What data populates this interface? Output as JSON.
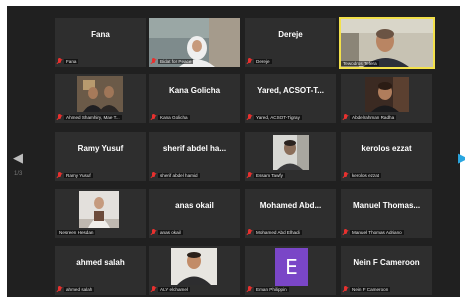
{
  "navigation": {
    "prev_arrow": "◀",
    "next_arrow": "▶",
    "page_left": "1/3"
  },
  "tiles": [
    {
      "display_name": "Fana",
      "label": "Fana",
      "muted": true,
      "has_video": false
    },
    {
      "display_name": "",
      "label": "Bidat for Peace",
      "muted": true,
      "has_video": true
    },
    {
      "display_name": "Dereje",
      "label": "Dereje",
      "muted": true,
      "has_video": false
    },
    {
      "display_name": "",
      "label": "Tewodros Tefera",
      "muted": false,
      "has_video": true,
      "active_speaker": true
    },
    {
      "display_name": "",
      "label": "Ahmed Shamhiry, Mae T...",
      "muted": true,
      "has_video": true
    },
    {
      "display_name": "Kana Golicha",
      "label": "Kana Golicha",
      "muted": true,
      "has_video": false
    },
    {
      "display_name": "Yared, ACSOT-T...",
      "label": "Yared, ACSOT-Tigray",
      "muted": true,
      "has_video": false
    },
    {
      "display_name": "",
      "label": "Abdelrahman Radha",
      "muted": true,
      "has_video": true
    },
    {
      "display_name": "Ramy Yusuf",
      "label": "Ramy Yusuf",
      "muted": true,
      "has_video": false
    },
    {
      "display_name": "sherif abdel ha...",
      "label": "sherif abdel hamid",
      "muted": true,
      "has_video": false
    },
    {
      "display_name": "",
      "label": "Essam Tawfy",
      "muted": true,
      "has_video": true
    },
    {
      "display_name": "kerolos ezzat",
      "label": "kerolos ezzat",
      "muted": true,
      "has_video": false
    },
    {
      "display_name": "",
      "label": "Nesreen Hesdan",
      "muted": false,
      "has_video": true
    },
    {
      "display_name": "anas okail",
      "label": "anas okail",
      "muted": true,
      "has_video": false
    },
    {
      "display_name": "Mohamed Abd...",
      "label": "Mohamed Abd Elhadi",
      "muted": true,
      "has_video": false
    },
    {
      "display_name": "Manuel Thomas...",
      "label": "Manuel Thomas Adriano",
      "muted": true,
      "has_video": false
    },
    {
      "display_name": "ahmed salah",
      "label": "ahmed salah",
      "muted": true,
      "has_video": false
    },
    {
      "display_name": "",
      "label": "ALY elchamel",
      "muted": true,
      "has_video": true
    },
    {
      "display_name": "",
      "label": "Eman Philippin",
      "muted": true,
      "has_video": false,
      "avatar_letter": "E"
    },
    {
      "display_name": "Nein F Cameroon",
      "label": "Nein F Cameroon",
      "muted": true,
      "has_video": false
    }
  ],
  "colors": {
    "background": "#202020",
    "tile": "#2e2e2e",
    "active_border": "#f3e14a",
    "muted_icon": "#e8312f",
    "avatar": "#7a46c7",
    "next_arrow": "#2aa6e0"
  }
}
